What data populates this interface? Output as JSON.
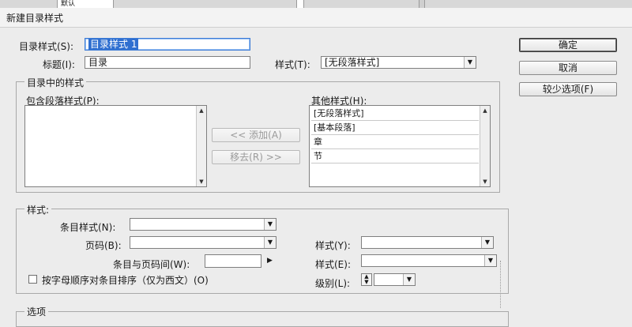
{
  "topstrip": {
    "tab_label": "默认"
  },
  "window": {
    "title": "新建目录样式"
  },
  "buttons": {
    "ok": "确定",
    "cancel": "取消",
    "fewer_options": "较少选项(F)"
  },
  "toc_style": {
    "label": "目录样式(S):",
    "value": "目录样式 1"
  },
  "title_field": {
    "label": "标题(I):",
    "value": "目录"
  },
  "title_style": {
    "label": "样式(T):",
    "value": "[无段落样式]"
  },
  "styles_in_toc": {
    "group_title": "目录中的样式",
    "include_label": "包含段落样式(P):",
    "other_label": "其他样式(H):",
    "add_button": "<< 添加(A)",
    "remove_button": "移去(R) >>",
    "other_items": [
      "[无段落样式]",
      "[基本段落]",
      "章",
      "节"
    ]
  },
  "style_section": {
    "group_title": "样式:",
    "entry_style_label": "条目样式(N):",
    "page_number_label": "页码(B):",
    "between_label": "条目与页码间(W):",
    "style_y_label": "样式(Y):",
    "style_e_label": "样式(E):",
    "sort_checkbox_label": "按字母顺序对条目排序（仅为西文）(O)",
    "level_label": "级别(L):"
  },
  "options_section": {
    "group_title": "选项"
  }
}
